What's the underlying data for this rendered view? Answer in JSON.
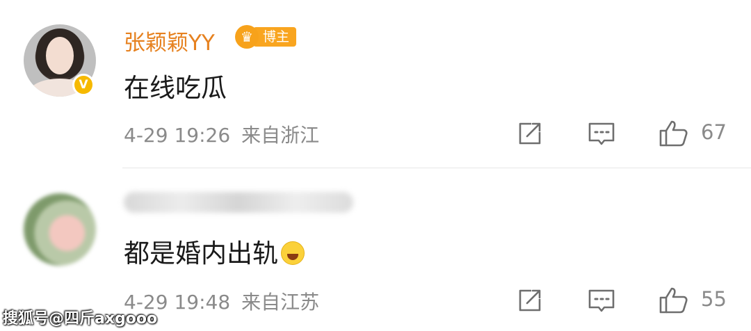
{
  "comments": [
    {
      "username": "张颖颖YY",
      "badge": "博主",
      "verified_icon": "V",
      "text": "在线吃瓜",
      "date": "4-29 19:26",
      "location": "来自浙江",
      "likes": "67"
    },
    {
      "username": "",
      "text": "都是婚内出轨",
      "emoji": "laughing-crying-emoji",
      "date": "4-29 19:48",
      "location": "来自江苏",
      "likes": "55"
    }
  ],
  "watermark": "搜狐号@四斤axgooo",
  "colors": {
    "username": "#e6811f",
    "badge": "#f9a51f",
    "verified": "#f6b900",
    "meta": "#8a8a8a"
  }
}
